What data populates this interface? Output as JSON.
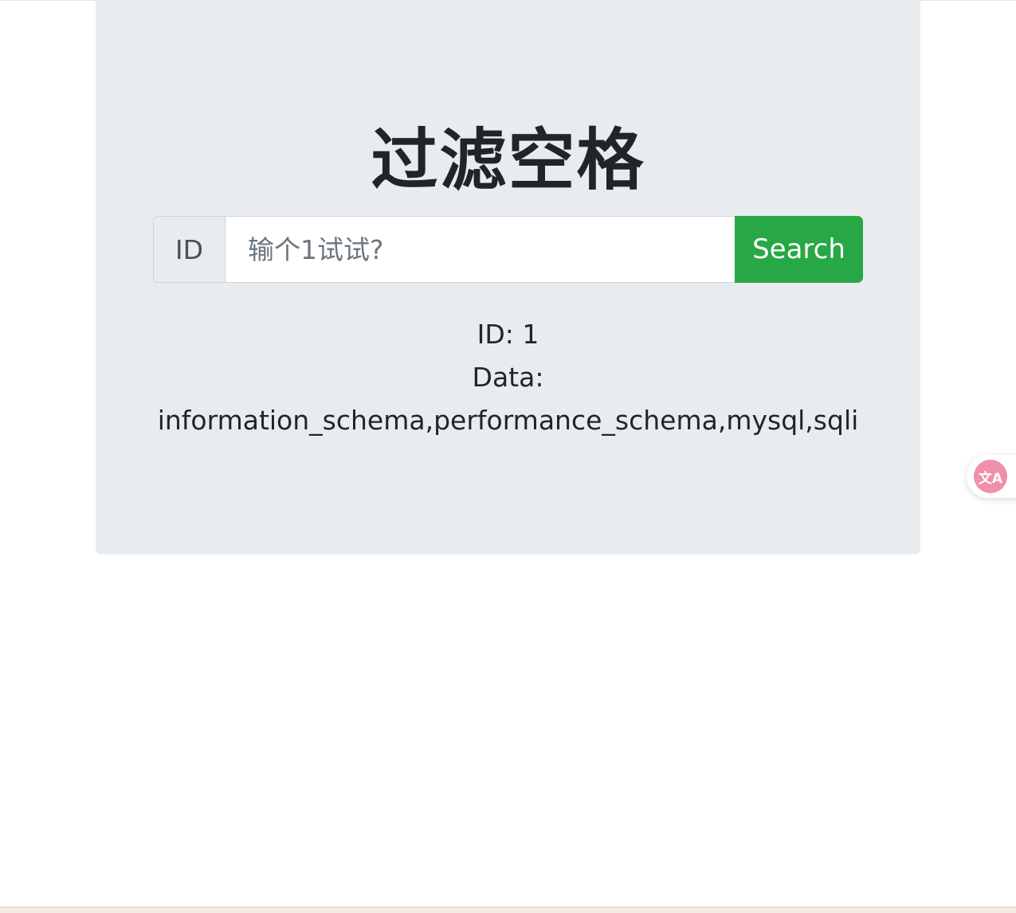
{
  "page": {
    "title": "过滤空格"
  },
  "search": {
    "addon_label": "ID",
    "placeholder": "输个1试试?",
    "value": "",
    "button_label": "Search"
  },
  "result": {
    "id_line": "ID: 1",
    "data_label": "Data:",
    "data_value": "information_schema,performance_schema,mysql,sqli"
  },
  "widgets": {
    "translate_icon": "translate-icon",
    "translate_glyph": "文A"
  },
  "colors": {
    "jumbotron_bg": "#e9ecef",
    "button_bg": "#28a745",
    "text": "#212529",
    "translate_accent": "#ef8fa8"
  }
}
